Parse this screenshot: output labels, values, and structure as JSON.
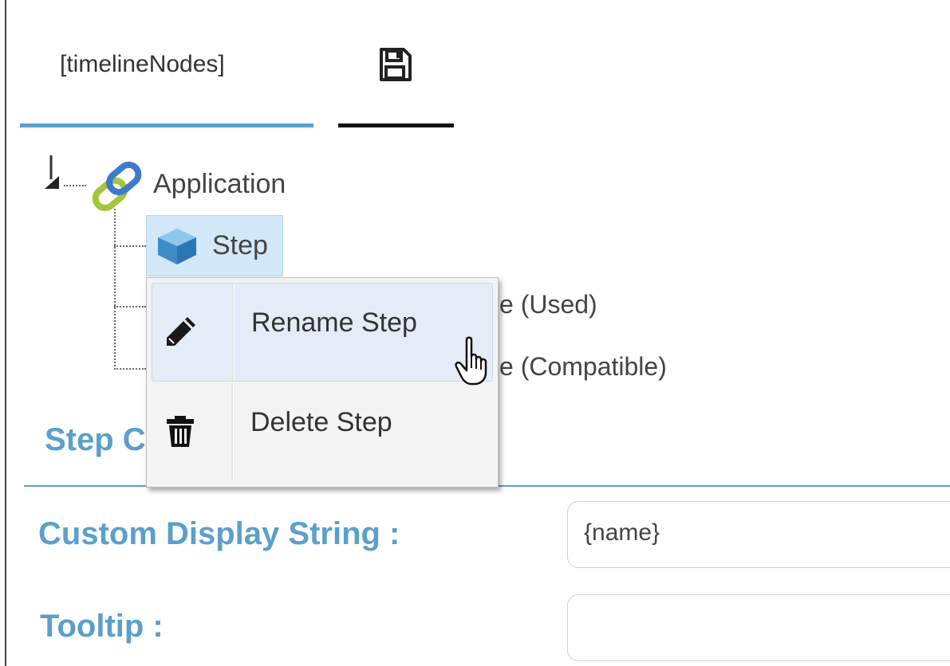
{
  "tabs": [
    {
      "label": "[timelineNodes]"
    }
  ],
  "tree": {
    "root": {
      "label": "Application",
      "icon": "link-icon"
    },
    "children": [
      {
        "label": "Step",
        "icon": "cube-icon",
        "selected": true
      },
      {
        "label_visible_fragment": "e (Used)"
      },
      {
        "label_visible_fragment": "e (Compatible)"
      }
    ]
  },
  "context_menu": {
    "items": [
      {
        "label": "Rename Step",
        "icon": "pencil-icon"
      },
      {
        "label": "Delete Step",
        "icon": "trash-icon"
      }
    ]
  },
  "section": {
    "heading_visible": "Step C"
  },
  "form": {
    "custom_display_label": "Custom Display String :",
    "custom_display_value": "{name}",
    "tooltip_label": "Tooltip :",
    "tooltip_value": ""
  },
  "colors": {
    "accent": "#5b9fcb",
    "selection": "#d3e8f8",
    "menu_hover": "#e3ecf7"
  }
}
